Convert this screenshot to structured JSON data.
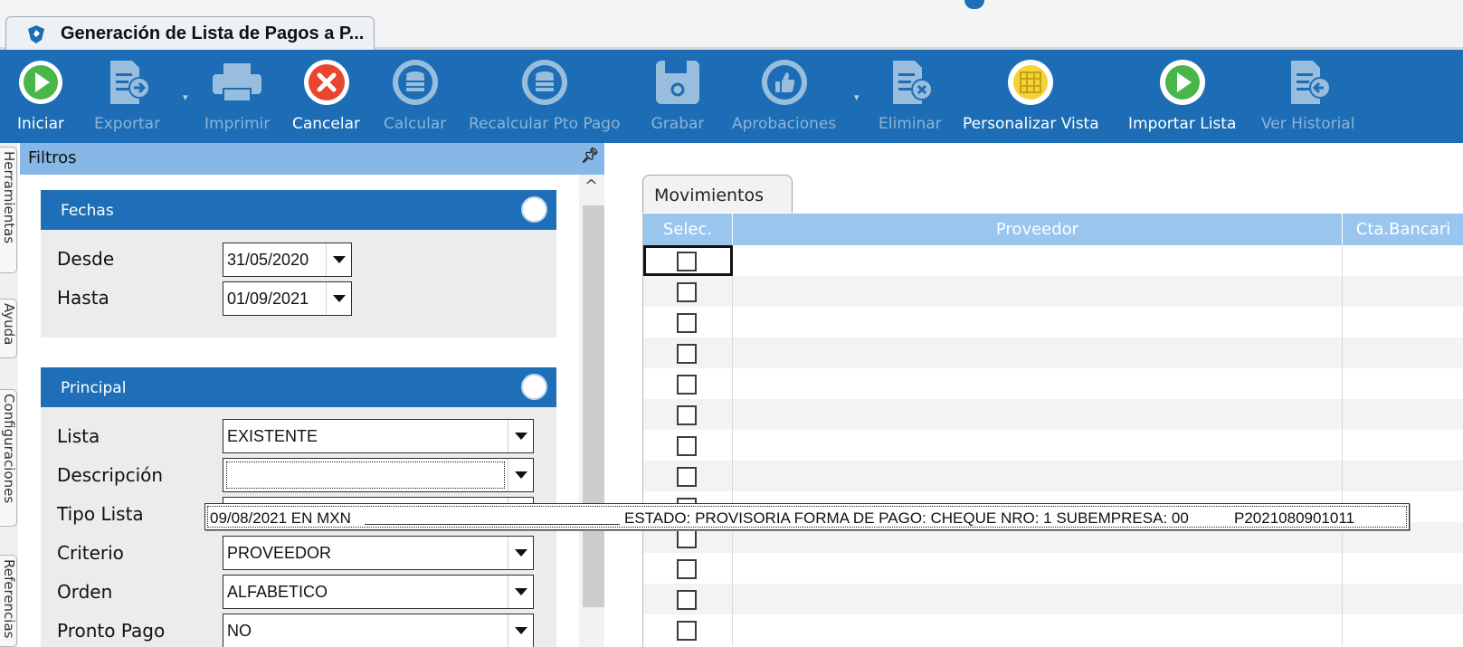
{
  "window": {
    "tab_title": "Generación de Lista de Pagos a P..."
  },
  "toolbar": {
    "buttons": [
      {
        "label": "Iniciar",
        "icon": "play-icon",
        "enabled": true
      },
      {
        "label": "Exportar",
        "icon": "export-icon",
        "enabled": false
      },
      {
        "label": "Imprimir",
        "icon": "printer-icon",
        "enabled": false
      },
      {
        "label": "Cancelar",
        "icon": "cancel-icon",
        "enabled": true
      },
      {
        "label": "Calcular",
        "icon": "database-icon",
        "enabled": false
      },
      {
        "label": "Recalcular Pto Pago",
        "icon": "database-icon",
        "enabled": false
      },
      {
        "label": "Grabar",
        "icon": "save-icon",
        "enabled": false
      },
      {
        "label": "Aprobaciones",
        "icon": "thumbs-up-icon",
        "enabled": false
      },
      {
        "label": "Eliminar",
        "icon": "delete-document-icon",
        "enabled": false
      },
      {
        "label": "Personalizar Vista",
        "icon": "grid-icon",
        "enabled": true
      },
      {
        "label": "Importar Lista",
        "icon": "play-icon",
        "enabled": true
      },
      {
        "label": "Ver Historial",
        "icon": "history-document-icon",
        "enabled": false
      }
    ]
  },
  "side_tabs": [
    "Herramientas",
    "Ayuda",
    "Configuraciones",
    "Referencias"
  ],
  "filters": {
    "title": "Filtros",
    "fechas": {
      "title": "Fechas",
      "desde_label": "Desde",
      "desde_value": "31/05/2020",
      "hasta_label": "Hasta",
      "hasta_value": "01/09/2021"
    },
    "principal": {
      "title": "Principal",
      "lista_label": "Lista",
      "lista_value": "EXISTENTE",
      "descripcion_label": "Descripción",
      "descripcion_value": "",
      "tipo_lista_label": "Tipo Lista",
      "criterio_label": "Criterio",
      "criterio_value": "PROVEEDOR",
      "orden_label": "Orden",
      "orden_value": "ALFABETICO",
      "pronto_pago_label": "Pronto Pago",
      "pronto_pago_value": "NO"
    }
  },
  "dropdown_option": {
    "fecha": "09/08/2021 EN MXN",
    "detalle": "ESTADO: PROVISORIA FORMA DE PAGO: CHEQUE NRO: 1 SUBEMPRESA: 00",
    "codigo": "P2021080901011"
  },
  "movimientos": {
    "tab_label": "Movimientos",
    "columns": [
      "Selec.",
      "Proveedor",
      "Cta.Bancari"
    ],
    "row_count": 13
  },
  "colors": {
    "toolbar_bg": "#1c6db5",
    "group_header": "#1e6fb7",
    "filters_header": "#86b7e6",
    "grid_header": "#9ac5ee"
  }
}
